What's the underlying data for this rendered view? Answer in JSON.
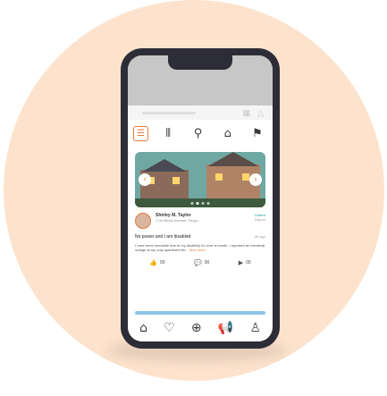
{
  "toolbar": {
    "items": [
      {
        "icon": "list-icon",
        "glyph": "☰",
        "active": true
      },
      {
        "icon": "bar-chart-icon",
        "glyph": "⫴",
        "active": false
      },
      {
        "icon": "tag-icon",
        "glyph": "⚲",
        "active": false
      },
      {
        "icon": "home-search-icon",
        "glyph": "⌂",
        "active": false
      },
      {
        "icon": "pin-icon",
        "glyph": "⚑",
        "active": false
      }
    ]
  },
  "listing": {
    "carousel_dots": 4,
    "active_dot": 1,
    "prev_glyph": "‹",
    "next_glyph": "›"
  },
  "post": {
    "author": "Shirley M. Taylor",
    "address": "2 De Beers Avenue, Fergo...",
    "badge_line1": "Citizen",
    "badge_line2": "Report",
    "title": "No power and I am disabled",
    "time": "28 ago",
    "body": "I have been immobile due to my disability for over a month. I reported an electrical outage at my only apartment thr...",
    "read_more": "read more",
    "reactions": [
      {
        "icon": "thumbs-up-icon",
        "glyph": "👍",
        "count": "00"
      },
      {
        "icon": "chat-icon",
        "glyph": "💬",
        "count": "00"
      },
      {
        "icon": "video-icon",
        "glyph": "▶",
        "count": "00"
      }
    ]
  },
  "progress": {
    "value": 1.0
  },
  "bottom_nav": {
    "items": [
      {
        "icon": "home-icon",
        "glyph": "⌂",
        "accent": false
      },
      {
        "icon": "heart-icon",
        "glyph": "♡",
        "accent": false
      },
      {
        "icon": "add-icon",
        "glyph": "⊕",
        "accent": false
      },
      {
        "icon": "megaphone-icon",
        "glyph": "📢",
        "accent": true
      },
      {
        "icon": "profile-icon",
        "glyph": "♙",
        "accent": false
      }
    ]
  },
  "colors": {
    "accent": "#e57a3b",
    "background_circle": "#fde3cd",
    "phone_frame": "#2d2d37",
    "teal": "#1a9a8e"
  }
}
